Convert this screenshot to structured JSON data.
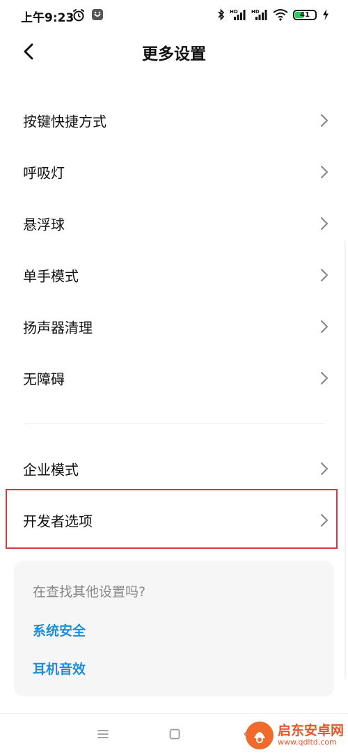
{
  "status_bar": {
    "time": "上午9:23",
    "battery_level": "41",
    "battery_fraction": 0.41,
    "icons": [
      "alarm-icon",
      "app-notification-icon",
      "bluetooth-icon",
      "hd-signal-1-icon",
      "hd-signal-2-icon",
      "wifi-icon",
      "battery-icon",
      "charging-icon"
    ]
  },
  "header": {
    "title": "更多设置",
    "back_icon": "chevron-left-icon"
  },
  "menu": {
    "items": [
      {
        "label": "按键快捷方式"
      },
      {
        "label": "呼吸灯"
      },
      {
        "label": "悬浮球"
      },
      {
        "label": "单手模式"
      },
      {
        "label": "扬声器清理"
      },
      {
        "label": "无障碍"
      },
      {
        "label": "企业模式"
      },
      {
        "label": "开发者选项"
      }
    ],
    "highlighted_item": "开发者选项",
    "highlight_color": "#d9363e"
  },
  "suggestions": {
    "title": "在查找其他设置吗?",
    "links": [
      "系统安全",
      "耳机音效"
    ],
    "link_color": "#1e8fd6"
  },
  "nav_bar": {
    "icons": [
      "menu-icon",
      "home-icon",
      "back-icon"
    ]
  },
  "watermark": {
    "name": "启东安卓网",
    "url": "www.qdltd.com"
  }
}
